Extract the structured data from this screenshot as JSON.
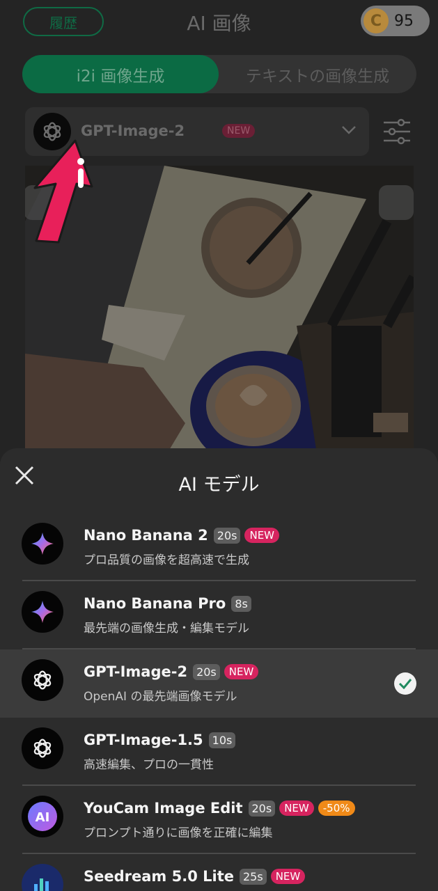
{
  "header": {
    "history_label": "履歴",
    "title": "AI 画像",
    "coin_symbol": "C",
    "coin_count": "95"
  },
  "mode_tabs": [
    {
      "label": "i2i 画像生成",
      "active": true
    },
    {
      "label": "テキストの画像生成",
      "active": false
    }
  ],
  "model_selector": {
    "name": "GPT-Image-2",
    "badge": "NEW"
  },
  "sheet": {
    "title": "AI モデル",
    "models": [
      {
        "name": "Nano Banana 2",
        "time": "20s",
        "new": "NEW",
        "discount": null,
        "desc": "プロ品質の画像を超高速で生成",
        "icon": "gemini-sparkle-icon",
        "selected": false
      },
      {
        "name": "Nano Banana Pro",
        "time": "8s",
        "new": null,
        "discount": null,
        "desc": "最先端の画像生成・編集モデル",
        "icon": "gemini-sparkle-icon",
        "selected": false
      },
      {
        "name": "GPT-Image-2",
        "time": "20s",
        "new": "NEW",
        "discount": null,
        "desc": "OpenAI の最先端画像モデル",
        "icon": "openai-icon",
        "selected": true
      },
      {
        "name": "GPT-Image-1.5",
        "time": "10s",
        "new": null,
        "discount": null,
        "desc": "高速編集、プロの一貫性",
        "icon": "openai-icon",
        "selected": false
      },
      {
        "name": "YouCam Image Edit",
        "time": "20s",
        "new": "NEW",
        "discount": "-50%",
        "desc": "プロンプト通りに画像を正確に編集",
        "icon": "youcam-ai-icon",
        "selected": false
      },
      {
        "name": "Seedream 5.0 Lite",
        "time": "25s",
        "new": "NEW",
        "discount": null,
        "desc": "",
        "icon": "seedream-icon",
        "selected": false
      }
    ]
  },
  "colors": {
    "accent_green": "#0b6b44",
    "new_badge": "#d6245f",
    "discount_badge": "#f08a18",
    "arrow_pink": "#e8205a"
  }
}
